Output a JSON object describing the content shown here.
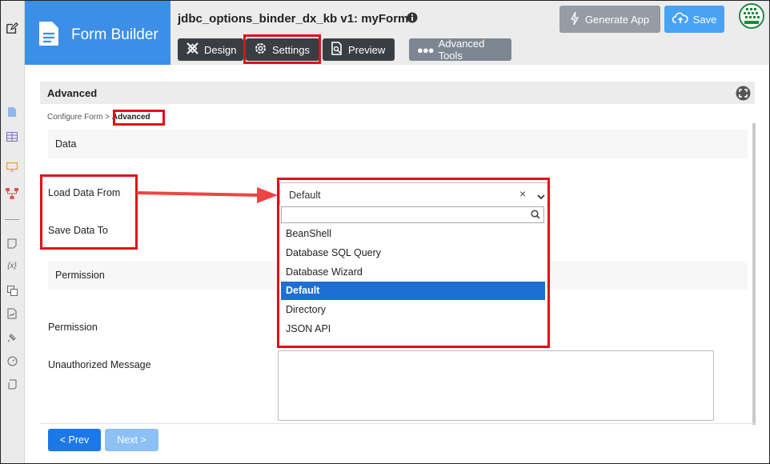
{
  "brand": {
    "title": "Form Builder"
  },
  "header": {
    "app_title": "jdbc_options_binder_dx_kb v1: myForm",
    "tabs": {
      "design": "Design",
      "settings": "Settings",
      "preview": "Preview"
    },
    "advanced_tools": "Advanced Tools",
    "generate_app": "Generate App",
    "save": "Save"
  },
  "panel": {
    "title": "Advanced",
    "breadcrumb": {
      "parent": "Configure Form",
      "separator": ">",
      "current": "Advanced"
    }
  },
  "sections": {
    "data": {
      "title": "Data",
      "load_label": "Load Data From",
      "save_label": "Save Data To"
    },
    "permission": {
      "title": "Permission",
      "permission_label": "Permission",
      "unauthorized_label": "Unauthorized Message"
    }
  },
  "select": {
    "value": "Default",
    "search_value": "",
    "options": [
      {
        "label": "BeanShell",
        "selected": false
      },
      {
        "label": "Database SQL Query",
        "selected": false
      },
      {
        "label": "Database Wizard",
        "selected": false
      },
      {
        "label": "Default",
        "selected": true
      },
      {
        "label": "Directory",
        "selected": false
      },
      {
        "label": "JSON API",
        "selected": false
      }
    ]
  },
  "nav": {
    "prev": "< Prev",
    "next": "Next >"
  },
  "colors": {
    "brand_blue": "#3d8ee6",
    "highlight_red": "#e01018",
    "selected_option": "#1e6fd4"
  },
  "icons": [
    "edit-icon",
    "document-icon",
    "info-icon",
    "design-icon",
    "gear-icon",
    "preview-icon",
    "dots-icon",
    "bolt-icon",
    "cloud-upload-icon",
    "fullscreen-icon",
    "search-icon",
    "clear-icon",
    "chevron-down-icon"
  ]
}
